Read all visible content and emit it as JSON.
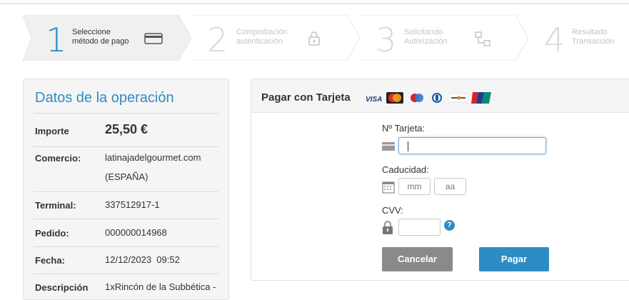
{
  "steps": [
    {
      "number": "1",
      "line1": "Seleccione",
      "line2": "método de pago",
      "icon": "card-icon",
      "state": "active"
    },
    {
      "number": "2",
      "line1": "Comprobación",
      "line2": "autenticación",
      "icon": "lock-icon",
      "state": "inactive"
    },
    {
      "number": "3",
      "line1": "Solicitando",
      "line2": "Autorización",
      "icon": "network-icon",
      "state": "inactive"
    },
    {
      "number": "4",
      "line1": "Resultado",
      "line2": "Transacción",
      "icon": "",
      "state": "inactive"
    }
  ],
  "operation": {
    "title": "Datos de la operación",
    "rows": [
      {
        "key": "Importe",
        "value": "25,50 €"
      },
      {
        "key": "Comercio:",
        "value": "latinajadelgourmet.com",
        "value2": "(ESPAÑA)"
      },
      {
        "key": "Terminal:",
        "value": "337512917-1"
      },
      {
        "key": "Pedido:",
        "value": "000000014968"
      },
      {
        "key": "Fecha:",
        "value": "12/12/2023  09:52"
      },
      {
        "key": "Descripción",
        "value": "1xRincón de la Subbética -"
      }
    ]
  },
  "payment": {
    "title": "Pagar con Tarjeta",
    "card_brands": [
      "VISA",
      "Mastercard",
      "Maestro",
      "Diners",
      "Discover",
      "UnionPay"
    ],
    "card_number_label": "Nº Tarjeta:",
    "card_number_value": "",
    "expiry_label": "Caducidad:",
    "month_placeholder": "mm",
    "year_placeholder": "aa",
    "cvv_label": "CVV:",
    "cvv_help": "?",
    "cancel_label": "Cancelar",
    "pay_label": "Pagar"
  },
  "colors": {
    "accent": "#2d8cc4",
    "cancel": "#8a8a8a",
    "pay": "#2d8cc4"
  }
}
